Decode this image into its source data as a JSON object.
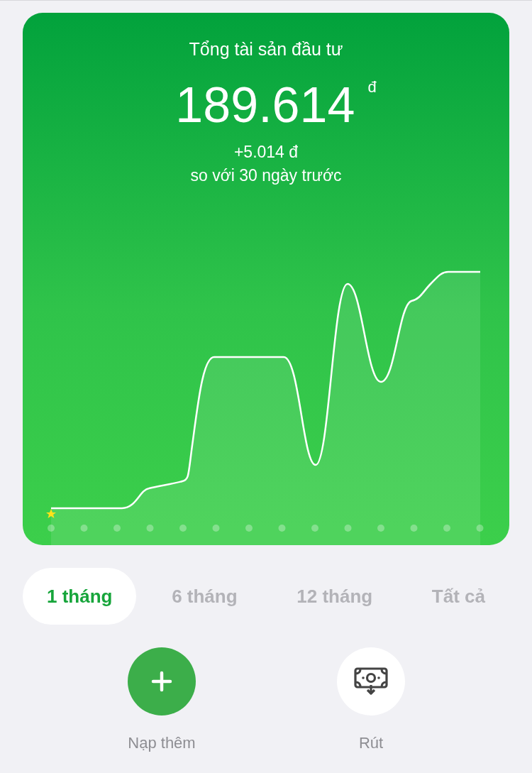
{
  "summary": {
    "title": "Tổng tài sản đầu tư",
    "amount": "189.614",
    "currency": "đ",
    "change": "+5.014 đ",
    "comparison": "so với 30 ngày trước"
  },
  "periods": [
    {
      "label": "1 tháng",
      "selected": true
    },
    {
      "label": "6 tháng",
      "selected": false
    },
    {
      "label": "12 tháng",
      "selected": false
    },
    {
      "label": "Tất cả",
      "selected": false
    }
  ],
  "actions": [
    {
      "kind": "deposit",
      "label": "Nạp thêm"
    },
    {
      "kind": "withdraw",
      "label": "Rút"
    }
  ]
}
